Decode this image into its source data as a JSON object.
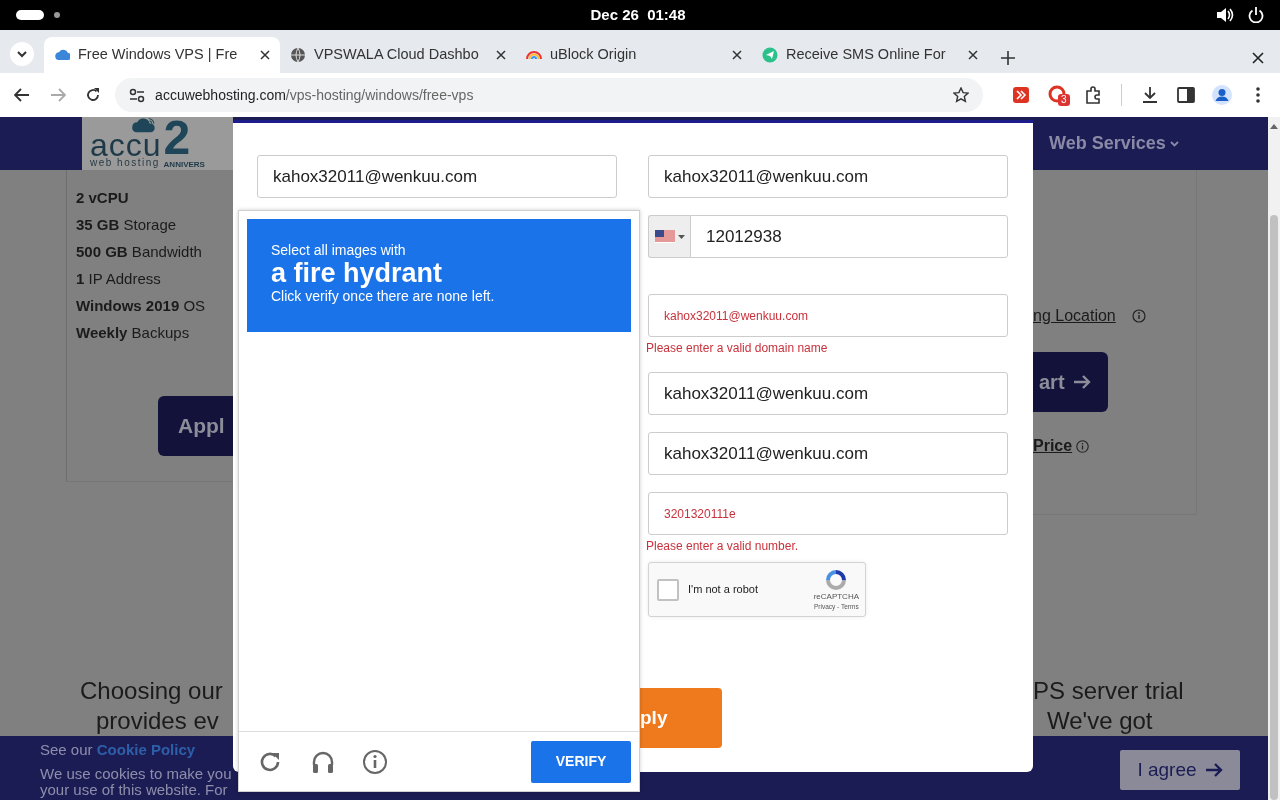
{
  "system_bar": {
    "clock": "Dec 26  01:48"
  },
  "tabs": [
    {
      "title": "Free Windows VPS | Fre",
      "selected": true
    },
    {
      "title": "VPSWALA Cloud Dashbo",
      "selected": false
    },
    {
      "title": "uBlock Origin",
      "selected": false
    },
    {
      "title": "Receive SMS Online For",
      "selected": false
    }
  ],
  "address_bar": {
    "domain": "accuwebhosting.com",
    "path": "/vps-hosting/windows/free-vps"
  },
  "extension_badge": "3",
  "site": {
    "logo": {
      "name": "accu",
      "tagline": "web hosting",
      "badge": "2",
      "badge_caption": "ANNIVERS"
    },
    "menu_item": "Web Services",
    "features": [
      "**2 vCPU**",
      "**35 GB** Storage",
      "**500 GB** Bandwidth",
      "**1** IP Address",
      "**Windows 2019** OS",
      "**Weekly** Backups"
    ],
    "apply_button": "Appl",
    "location_link": "ng Location",
    "cart_button": "art",
    "price_link": "Price",
    "intro_left": [
      "Choosing our",
      "provides ev"
    ],
    "intro_right": [
      "PS server trial",
      "We've got"
    ],
    "cookie": {
      "lead": "See our",
      "link": "Cookie Policy",
      "lines": [
        "We use cookies to make you",
        "your use of this website. For"
      ],
      "agree": "I agree"
    }
  },
  "modal": {
    "left_fields": [
      {
        "value": "kahox32011@wenkuu.com"
      }
    ],
    "right_fields": [
      {
        "kind": "text",
        "value": "kahox32011@wenkuu.com",
        "invalid": false
      },
      {
        "kind": "phone",
        "value": "12012938",
        "invalid": false
      },
      {
        "kind": "text",
        "value": "kahox32011@wenkuu.com",
        "invalid": true,
        "error": "Please enter a valid domain name"
      },
      {
        "kind": "text",
        "value": "kahox32011@wenkuu.com",
        "invalid": false
      },
      {
        "kind": "text",
        "value": "kahox32011@wenkuu.com",
        "invalid": false
      },
      {
        "kind": "text",
        "value": "3201320111e",
        "invalid": true,
        "error": "Please enter a valid number."
      }
    ],
    "recaptcha": {
      "label": "I'm not a robot",
      "checked": false,
      "brand": "reCAPTCHA",
      "legal": "Privacy - Terms"
    },
    "submit": "ply"
  },
  "captcha": {
    "prompt": "Select all images with",
    "target": "a fire hydrant",
    "hint": "Click verify once there are none left.",
    "verify": "VERIFY"
  }
}
